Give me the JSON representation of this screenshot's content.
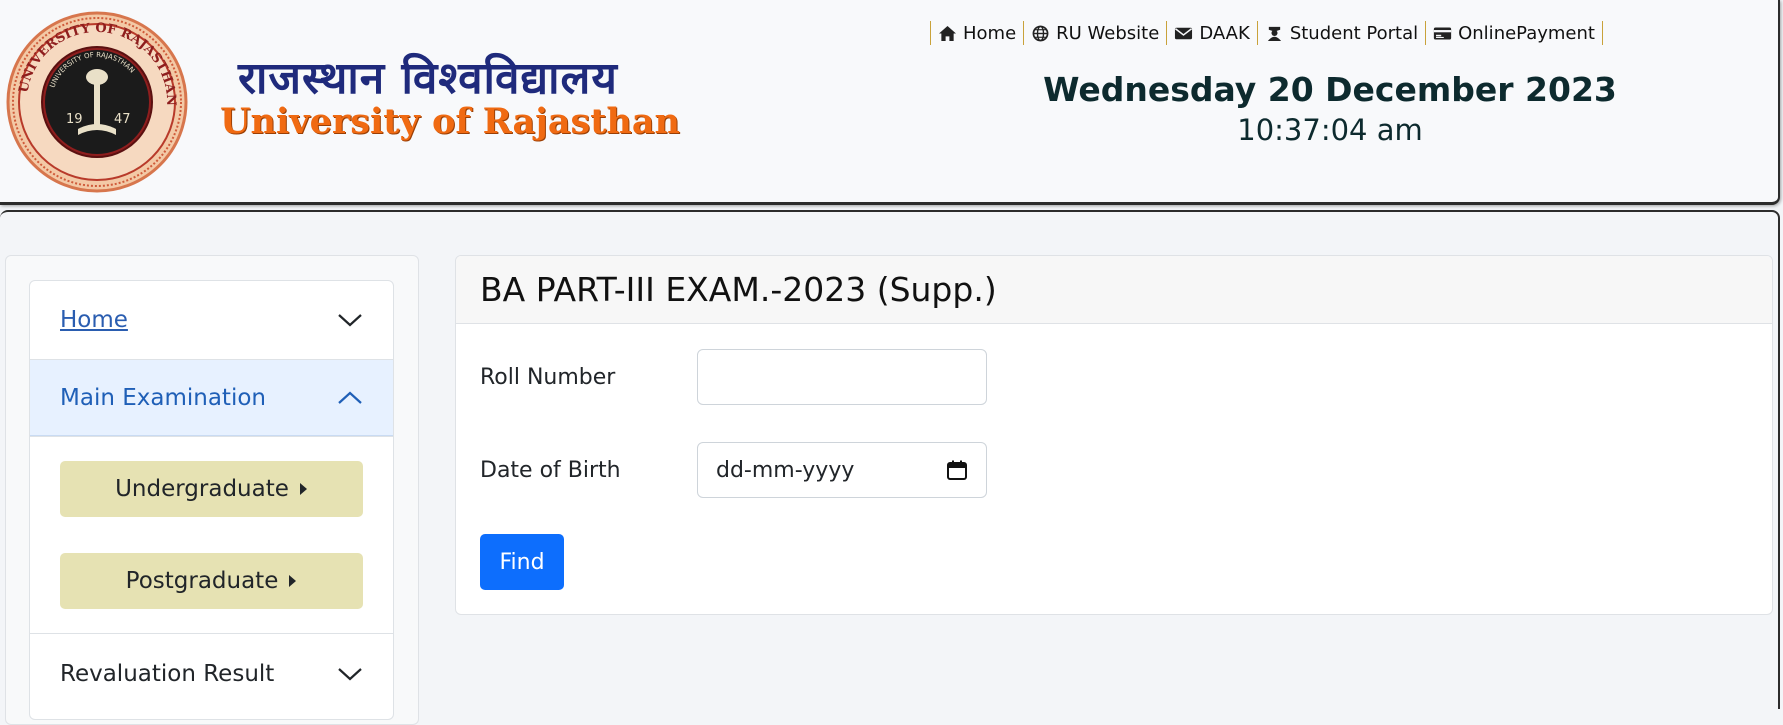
{
  "header": {
    "brand_hindi": "राजस्थान विश्वविद्यालय",
    "brand_english": "University of Rajasthan",
    "nav": [
      {
        "label": "Home",
        "icon": "home-icon"
      },
      {
        "label": "RU Website",
        "icon": "globe-icon"
      },
      {
        "label": "DAAK",
        "icon": "envelope-icon"
      },
      {
        "label": "Student Portal",
        "icon": "student-icon"
      },
      {
        "label": "OnlinePayment",
        "icon": "credit-card-icon"
      }
    ],
    "date": "Wednesday 20 December 2023",
    "time": "10:37:04 am",
    "seal": {
      "outer_text": "UNIVERSITY OF RAJASTHAN",
      "inner_text": "UNIVERSITY OF RAJASTHAN",
      "year_left": "19",
      "year_right": "47"
    }
  },
  "sidebar": {
    "home_label": "Home",
    "main_exam_label": "Main Examination",
    "undergraduate_label": "Undergraduate",
    "postgraduate_label": "Postgraduate",
    "revaluation_label": "Revaluation Result"
  },
  "exam": {
    "title": "BA PART-III EXAM.-2023 (Supp.)",
    "roll_label": "Roll Number",
    "roll_value": "",
    "dob_label": "Date of Birth",
    "dob_placeholder": "dd-mm-yyyy",
    "find_label": "Find"
  },
  "colors": {
    "accent_blue": "#0d6efd",
    "brand_orange": "#f06a12",
    "brand_navy": "#1f2a7c",
    "sub_button": "#e6e2b3",
    "seal_maroon": "#8e1e1e"
  }
}
